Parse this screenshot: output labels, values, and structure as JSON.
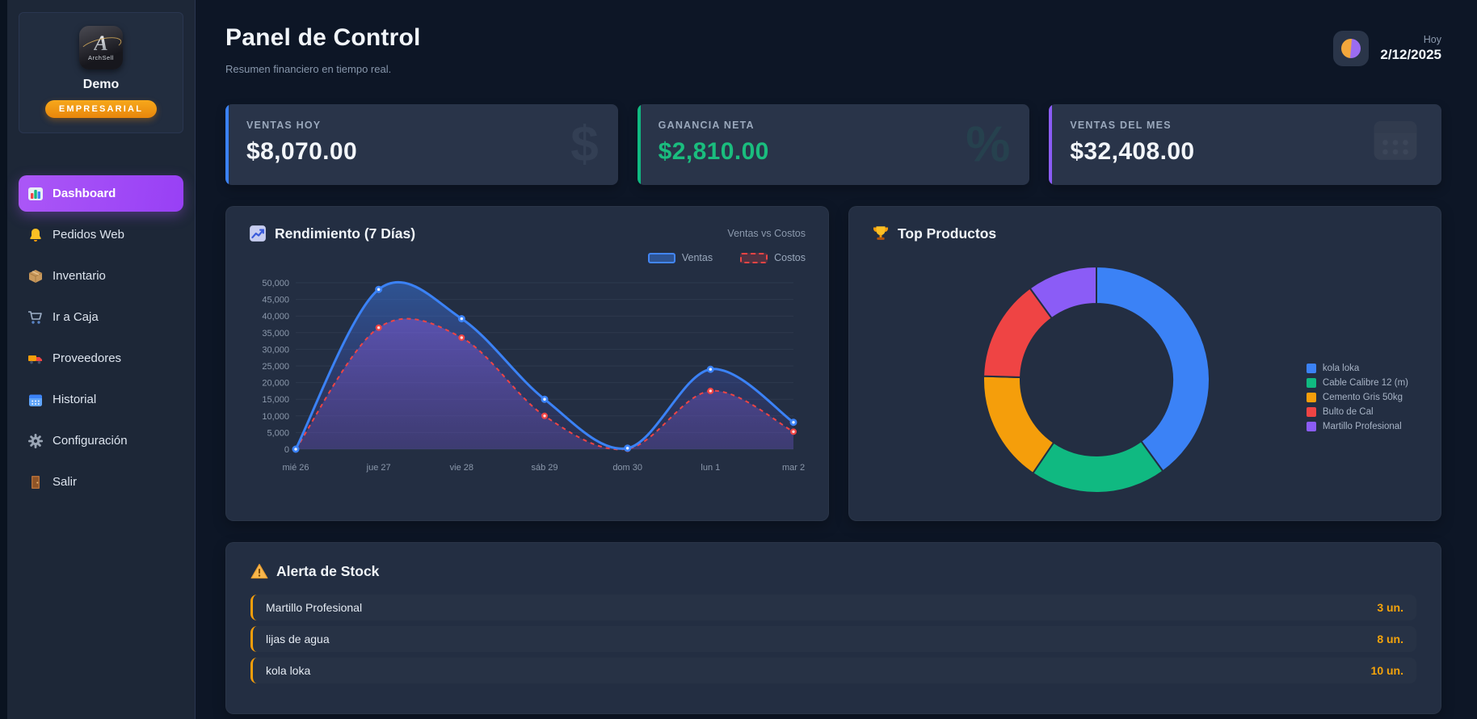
{
  "app": {
    "logo_letter": "A",
    "logo_wordmark": "ArchSell",
    "user_name": "Demo",
    "plan_badge": "EMPRESARIAL"
  },
  "sidebar": {
    "items": [
      {
        "label": "Dashboard",
        "icon": "bar-chart-icon",
        "active": true
      },
      {
        "label": "Pedidos Web",
        "icon": "bell-icon",
        "active": false
      },
      {
        "label": "Inventario",
        "icon": "box-icon",
        "active": false
      },
      {
        "label": "Ir a Caja",
        "icon": "cart-icon",
        "active": false
      },
      {
        "label": "Proveedores",
        "icon": "truck-icon",
        "active": false
      },
      {
        "label": "Historial",
        "icon": "calendar-icon",
        "active": false
      },
      {
        "label": "Configuración",
        "icon": "gear-icon",
        "active": false
      },
      {
        "label": "Salir",
        "icon": "door-icon",
        "active": false
      }
    ]
  },
  "header": {
    "title": "Panel de Control",
    "subtitle": "Resumen financiero en tiempo real.",
    "date_label": "Hoy",
    "date_value": "2/12/2025",
    "theme_icon": "theme-orb-icon"
  },
  "stats": [
    {
      "label": "VENTAS HOY",
      "value": "$8,070.00",
      "accent": "#3b82f6",
      "value_color": "#f3f6fa",
      "watermark_glyph": "$",
      "watermark_color": "rgba(148,163,184,0.10)"
    },
    {
      "label": "GANANCIA NETA",
      "value": "$2,810.00",
      "accent": "#10b981",
      "value_color": "#1abd7e",
      "watermark_glyph": "%",
      "watermark_color": "rgba(16,185,129,0.10)"
    },
    {
      "label": "VENTAS DEL MES",
      "value": "$32,408.00",
      "accent": "#8b5cf6",
      "value_color": "#f3f6fa",
      "watermark_glyph": "calendar-icon",
      "watermark_color": "rgba(148,163,184,0.10)"
    }
  ],
  "chart_data": [
    {
      "type": "line",
      "title": "Rendimiento (7 Días)",
      "subtitle": "Ventas vs Costos",
      "title_icon": "chart-up-icon",
      "categories": [
        "mié 26",
        "jue 27",
        "vie 28",
        "sáb 29",
        "dom 30",
        "lun 1",
        "mar 2"
      ],
      "series": [
        {
          "name": "Ventas",
          "color": "#3b82f6",
          "dashed": false,
          "values": [
            0,
            48000,
            39200,
            15000,
            300,
            24000,
            8070
          ]
        },
        {
          "name": "Costos",
          "color": "#ef4444",
          "dashed": true,
          "values": [
            0,
            36500,
            33500,
            10000,
            100,
            17500,
            5260
          ]
        }
      ],
      "ylim": [
        0,
        50000
      ],
      "ytick_step": 5000,
      "grid": true,
      "legend_position": "top-right"
    },
    {
      "type": "doughnut",
      "title": "Top Productos",
      "title_icon": "trophy-icon",
      "labels": [
        "kola loka",
        "Cable Calibre 12 (m)",
        "Cemento Gris 50kg",
        "Bulto de Cal",
        "Martillo Profesional"
      ],
      "values": [
        40,
        19.5,
        16,
        14.5,
        10
      ],
      "colors": [
        "#3b82f6",
        "#10b981",
        "#f59e0b",
        "#ef4444",
        "#8b5cf6"
      ],
      "legend_position": "right"
    }
  ],
  "stock": {
    "title": "Alerta de Stock",
    "title_icon": "warning-icon",
    "accent": "#f59e0b",
    "items": [
      {
        "name": "Martillo Profesional",
        "qty_label": "3 un."
      },
      {
        "name": "lijas de agua",
        "qty_label": "8 un."
      },
      {
        "name": "kola loka",
        "qty_label": "10 un."
      }
    ]
  }
}
